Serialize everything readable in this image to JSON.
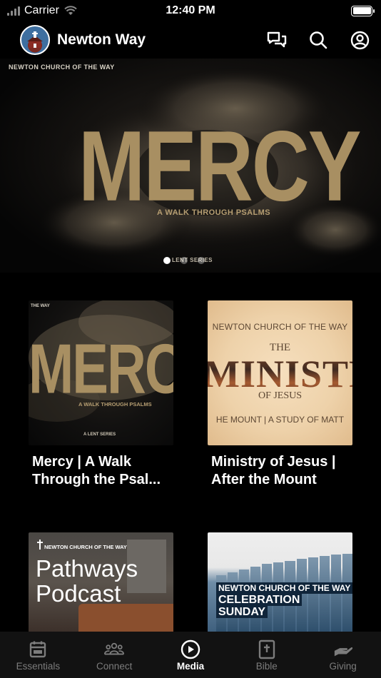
{
  "status_bar": {
    "carrier": "Carrier",
    "time": "12:40 PM"
  },
  "header": {
    "app_title": "Newton Way",
    "icons": [
      "chat-icon",
      "search-icon",
      "profile-icon"
    ]
  },
  "hero": {
    "brand": "NEWTON CHURCH OF THE WAY",
    "title": "MERCY",
    "subtitle": "A WALK THROUGH PSALMS",
    "series": "LENT SERIES",
    "slides": 3,
    "active_slide": 0
  },
  "media": [
    {
      "title": "Mercy | A Walk Through the Psal...",
      "art": {
        "brand": "THE WAY",
        "title": "MERCY",
        "subtitle": "A WALK THROUGH PSALMS",
        "series": "A LENT SERIES"
      }
    },
    {
      "title": "Ministry of Jesus | After the Mount",
      "art": {
        "top": "NEWTON CHURCH OF THE WAY",
        "the": "THE",
        "big": "MINISTRY",
        "of": "OF JESUS",
        "bottom": "HE MOUNT  |  A STUDY OF MATT"
      }
    },
    {
      "title": "",
      "art": {
        "brand": "NEWTON CHURCH OF THE WAY",
        "line1": "Pathways",
        "line2": "Podcast"
      }
    },
    {
      "title": "",
      "art": {
        "brand": "NEWTON CHURCH OF THE WAY",
        "line1": "CELEBRATION",
        "line2": "SUNDAY"
      }
    }
  ],
  "tabs": [
    {
      "label": "Essentials",
      "icon": "calendar-icon",
      "active": false
    },
    {
      "label": "Connect",
      "icon": "group-icon",
      "active": false
    },
    {
      "label": "Media",
      "icon": "play-circle-icon",
      "active": true
    },
    {
      "label": "Bible",
      "icon": "bible-icon",
      "active": false
    },
    {
      "label": "Giving",
      "icon": "giving-hand-icon",
      "active": false
    }
  ],
  "colors": {
    "background": "#000000",
    "accent_gold": "#a88f62",
    "tabbar": "#121212",
    "inactive": "#7c7c7c"
  }
}
